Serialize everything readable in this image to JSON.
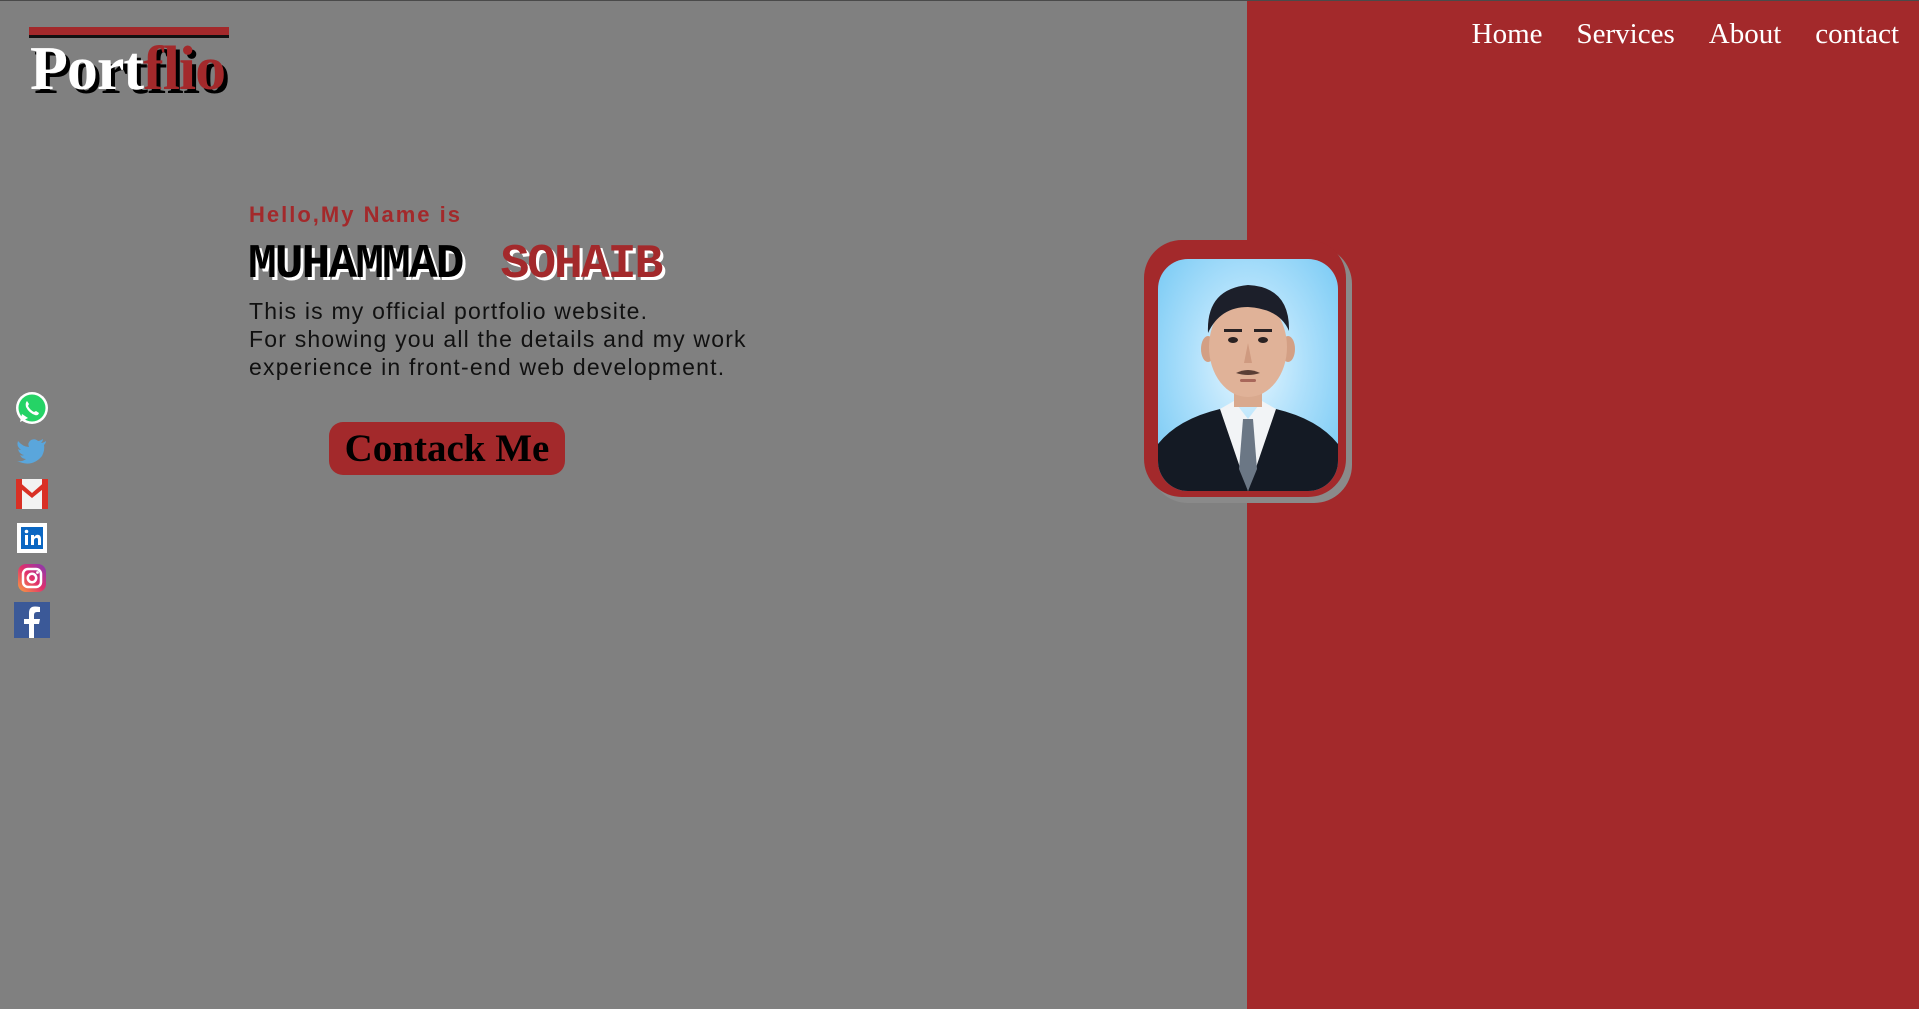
{
  "header": {
    "logo_part1": "Port",
    "logo_part2": "flio",
    "nav": [
      {
        "label": "Home"
      },
      {
        "label": "Services"
      },
      {
        "label": "About"
      },
      {
        "label": "contact"
      }
    ]
  },
  "hero": {
    "greeting": "Hello,My Name is",
    "first_name": "MUHAMMAD",
    "last_name": "SOHAIB",
    "intro_lines": [
      "This is my official portfolio website.",
      "For showing you all the details and my work",
      "experience in front-end web development."
    ],
    "contact_button": "Contack Me"
  },
  "social_icons": [
    "whatsapp-icon",
    "twitter-icon",
    "gmail-icon",
    "linkedin-icon",
    "instagram-icon",
    "facebook-icon"
  ],
  "colors": {
    "background": "#808080",
    "accent": "#a3292b",
    "text": "#111111"
  }
}
